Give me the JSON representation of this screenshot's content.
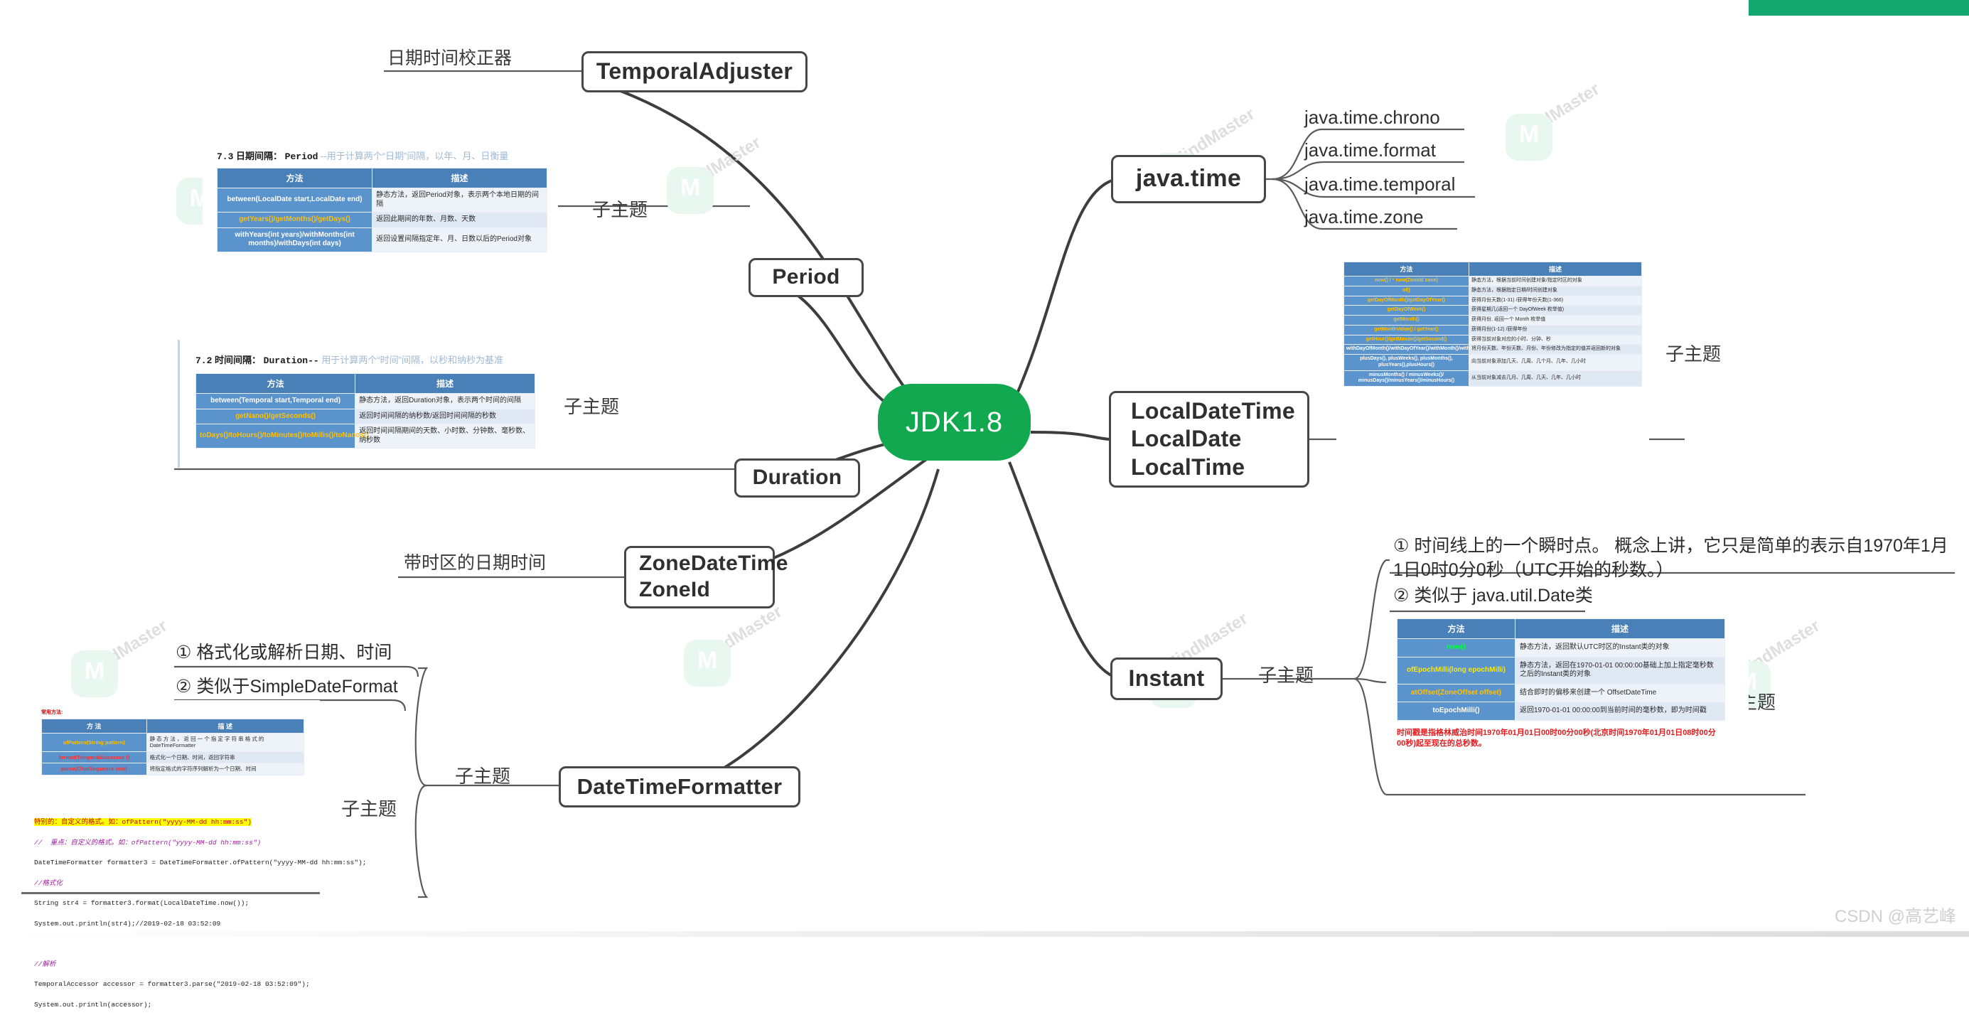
{
  "root": {
    "label": "JDK1.8"
  },
  "topbar": {
    "color": "#13a86f"
  },
  "watermark": {
    "brand": "MindMaster",
    "csdn": "CSDN @高艺峰"
  },
  "branches": {
    "temporal_adjuster": {
      "node": "TemporalAdjuster",
      "caption": "日期时间校正器"
    },
    "period": {
      "node": "Period",
      "caption": "子主题"
    },
    "duration": {
      "node": "Duration",
      "caption": "子主题"
    },
    "zone": {
      "node": "ZoneDateTime\nZoneId",
      "line1": "ZoneDateTime",
      "line2": "ZoneId",
      "caption": "带时区的日期时间"
    },
    "formatter": {
      "node": "DateTimeFormatter",
      "caption": "子主题",
      "caption2": "子主题"
    },
    "javatime": {
      "node": "java.time",
      "leaves": [
        "java.time.chrono",
        "java.time.format",
        "java.time.temporal",
        "java.time.zone"
      ]
    },
    "localdatetime": {
      "line1": "LocalDateTime",
      "line2": "LocalDate",
      "line3": "LocalTime",
      "caption": "子主题"
    },
    "instant": {
      "node": "Instant",
      "caption": "子主题",
      "caption2": "子主题"
    }
  },
  "period_slide": {
    "title_num": "7.3",
    "title_main": "日期间隔：",
    "title_cls": "Period",
    "title_desc": "--用于计算两个“日期”间隔，以年、月、日衡量",
    "headers": [
      "方法",
      "描述"
    ],
    "rows": [
      {
        "method": "between(LocalDate start,LocalDate end)",
        "desc": "静态方法，返回Period对象，表示两个本地日期的间隔"
      },
      {
        "method": "getYears()/getMonths()/getDays()",
        "desc": "返回此期间的年数、月数、天数"
      },
      {
        "method": "withYears(int years)/withMonths(int months)/withDays(int days)",
        "desc": "返回设置间隔指定年、月、日数以后的Period对象"
      }
    ]
  },
  "duration_slide": {
    "title_num": "7.2",
    "title_main": "时间间隔：",
    "title_cls": "Duration--",
    "title_desc": "用于计算两个“时间”间隔，以秒和纳秒为基准",
    "headers": [
      "方法",
      "描述"
    ],
    "rows": [
      {
        "method": "between(Temporal start,Temporal end)",
        "desc": "静态方法，返回Duration对象，表示两个时间的间隔"
      },
      {
        "method": "getNano()/getSeconds()",
        "desc": "返回时间间隔的纳秒数/返回时间间隔的秒数"
      },
      {
        "method": "toDays()/toHours()/toMinutes()/toMillis()/toNanos()",
        "desc": "返回时间间隔期间的天数、小时数、分钟数、毫秒数、纳秒数"
      }
    ]
  },
  "localdatetime_slide": {
    "headers": [
      "方法",
      "描述"
    ],
    "rows": [
      {
        "method": "now() / * now(ZoneId zone)",
        "desc": "静态方法，根据当前时间创建对象/指定时区的对象"
      },
      {
        "method": "of()",
        "desc": "静态方法，根据指定日期/时间创建对象"
      },
      {
        "method": "getDayOfMonth()/getDayOfYear()",
        "desc": "获得月份天数(1-31) /获得年份天数(1-366)"
      },
      {
        "method": "getDayOfWeek()",
        "desc": "获得星期几(返回一个 DayOfWeek 枚举值)"
      },
      {
        "method": "getMonth()",
        "desc": "获得月份, 返回一个 Month 枚举值"
      },
      {
        "method": "getMonthValue() / getYear()",
        "desc": "获得月份(1-12) /获得年份"
      },
      {
        "method": "getHour()/getMinute()/getSecond()",
        "desc": "获得当前对象对应的小时、分钟、秒"
      },
      {
        "method": "withDayOfMonth()/withDayOfYear()/withMonth()/withYear()",
        "desc": "将月份天数、年份天数、月份、年份修改为指定的值并返回新的对象"
      },
      {
        "method": "plusDays(), plusWeeks(), plusMonths(), plusYears(),plusHours()",
        "desc": "向当前对象添加几天、几周、几个月、几年、几小时"
      },
      {
        "method": "minusMonths() / minusWeeks()/ minusDays()/minusYears()/minusHours()",
        "desc": "从当前对象减去几月、几周、几天、几年、几小时"
      }
    ]
  },
  "instant_slide": {
    "note1": "① 时间线上的一个瞬时点。 概念上讲，它只是简单的表示自1970年1月1日0时0分0秒（UTC开始的秒数。）",
    "note2": "② 类似于 java.util.Date类",
    "headers": [
      "方法",
      "描述"
    ],
    "rows": [
      {
        "method": "now()",
        "desc": "静态方法，返回默认UTC时区的Instant类的对象"
      },
      {
        "method": "ofEpochMilli(long epochMilli)",
        "desc": "静态方法，返回在1970-01-01 00:00:00基础上加上指定毫秒数之后的Instant类的对象"
      },
      {
        "method": "atOffset(ZoneOffset offset)",
        "desc": "结合即时的偏移来创建一个 OffsetDateTime"
      },
      {
        "method": "toEpochMilli()",
        "desc": "返回1970-01-01 00:00:00到当前时间的毫秒数，即为时间戳"
      }
    ],
    "footnote": "时间戳是指格林威治时间1970年01月01日00时00分00秒(北京时间1970年01月01日08时00分00秒)起至现在的总秒数。"
  },
  "formatter_slide": {
    "note1": "① 格式化或解析日期、时间",
    "note2": "② 类似于SimpleDateFormat",
    "caption": "常用方法:",
    "headers": [
      "方 法",
      "描 述"
    ],
    "rows": [
      {
        "method": "ofPattern(String pattern)",
        "desc": "静 态 方 法 ， 返 回 一 个 指 定 字 符 串 格 式 的 DateTimeFormatter"
      },
      {
        "method": "format(TemporalAccessor t)",
        "desc": "格式化一个日期、时间，返回字符串"
      },
      {
        "method": "parse(CharSequence text)",
        "desc": "将指定格式的字符序列解析为一个日期、时间"
      }
    ],
    "code_lines": [
      "特别的：自定义的格式。如：ofPattern(\"yyyy-MM-dd hh:mm:ss\")",
      "//  重点：自定义的格式。如：ofPattern(\"yyyy-MM-dd hh:mm:ss\")",
      "DateTimeFormatter formatter3 = DateTimeFormatter.ofPattern(\"yyyy-MM-dd hh:mm:ss\");",
      "//格式化",
      "String str4 = formatter3.format(LocalDateTime.now());",
      "System.out.println(str4);//2019-02-18 03:52:09",
      "",
      "//解析",
      "TemporalAccessor accessor = formatter3.parse(\"2019-02-18 03:52:09\");",
      "System.out.println(accessor);"
    ]
  }
}
